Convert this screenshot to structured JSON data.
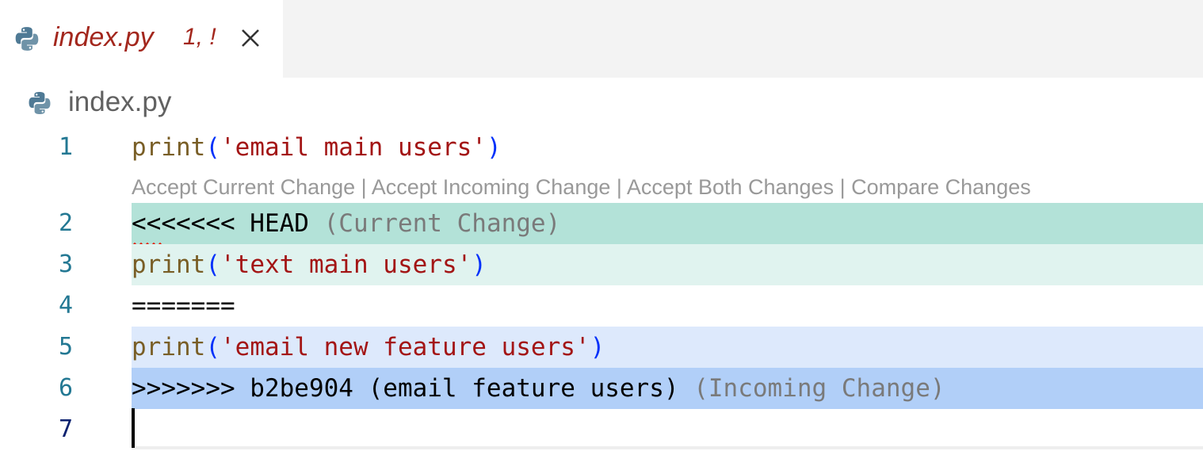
{
  "tab": {
    "title": "index.py",
    "badge": "1, !",
    "icon": "python-icon",
    "close_icon": "close-icon"
  },
  "breadcrumb": {
    "file": "index.py",
    "icon": "python-icon"
  },
  "codelens": {
    "accept_current": "Accept Current Change",
    "accept_incoming": "Accept Incoming Change",
    "accept_both": "Accept Both Changes",
    "compare": "Compare Changes",
    "separator": " | "
  },
  "lines": [
    {
      "number": "1",
      "func": "print",
      "open": "(",
      "str": "'email main users'",
      "close": ")"
    },
    {
      "number": "2",
      "marker": "<<<<<<< HEAD",
      "label": "(Current Change)"
    },
    {
      "number": "3",
      "func": "print",
      "open": "(",
      "str": "'text main users'",
      "close": ")"
    },
    {
      "number": "4",
      "marker": "======="
    },
    {
      "number": "5",
      "func": "print",
      "open": "(",
      "str": "'email new feature users'",
      "close": ")"
    },
    {
      "number": "6",
      "marker": ">>>>>>> b2be904 (email feature users)",
      "label": "(Incoming Change)"
    },
    {
      "number": "7"
    }
  ],
  "colors": {
    "current_header": "#b3e2d8",
    "current_body": "#e0f3ef",
    "incoming_body": "#dde9fc",
    "incoming_header": "#b1cff8",
    "error_text": "#a3271d"
  }
}
